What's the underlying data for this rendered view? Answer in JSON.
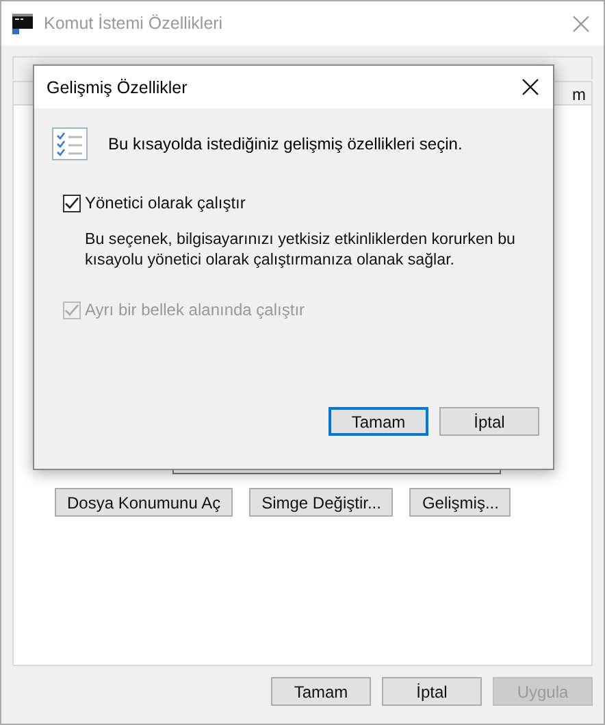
{
  "window": {
    "title": "Komut İstemi Özellikleri"
  },
  "tabs": [
    {
      "selected": false
    },
    {
      "label": "m",
      "selected": false
    }
  ],
  "panel_buttons": [
    "Dosya Konumunu Aç",
    "Simge Değiştir...",
    "Gelişmiş..."
  ],
  "buttons": [
    {
      "label": "Tamam",
      "disabled": false
    },
    {
      "label": "İptal",
      "disabled": false
    },
    {
      "label": "Uygula",
      "disabled": true
    }
  ],
  "dialog": {
    "title": "Gelişmiş Özellikler",
    "intro": "Bu kısayolda istediğiniz gelişmiş özellikleri seçin.",
    "options": [
      {
        "label": "Yönetici olarak çalıştır",
        "checked": true,
        "disabled": false,
        "description": "Bu seçenek, bilgisayarınızı yetkisiz etkinliklerden korurken bu kısayolu yönetici olarak çalıştırmanıza olanak sağlar."
      },
      {
        "label": "Ayrı bir bellek alanında çalıştır",
        "checked": true,
        "disabled": true
      }
    ],
    "buttons": [
      {
        "label": "Tamam",
        "default": true
      },
      {
        "label": "İptal",
        "default": false
      }
    ]
  }
}
